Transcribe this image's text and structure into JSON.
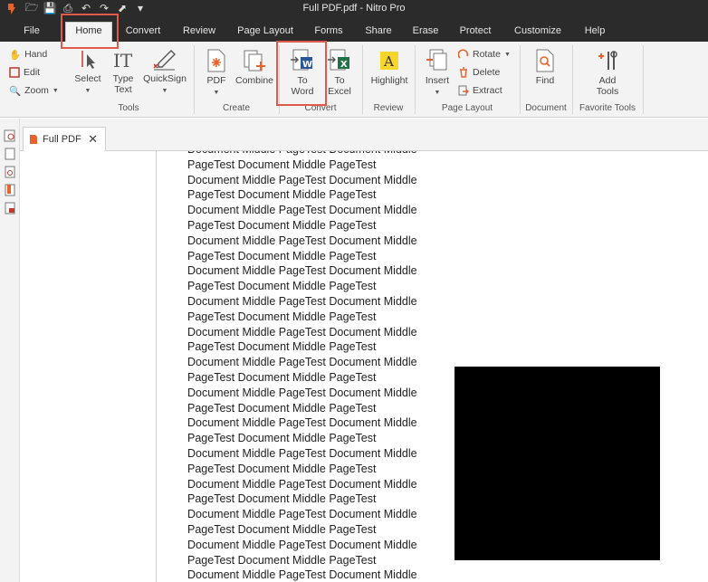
{
  "window": {
    "title": "Full PDF.pdf - Nitro Pro"
  },
  "tabs": [
    "File",
    "Home",
    "Convert",
    "Review",
    "Page Layout",
    "Forms",
    "Share",
    "Erase",
    "Protect",
    "Customize",
    "Help"
  ],
  "ribbon": {
    "tools": {
      "hand": "Hand",
      "edit": "Edit",
      "zoom": "Zoom",
      "select": "Select",
      "type_text_1": "Type",
      "type_text_2": "Text",
      "quicksign": "QuickSign",
      "group": "Tools"
    },
    "create": {
      "pdf": "PDF",
      "combine": "Combine",
      "group": "Create"
    },
    "convert": {
      "to_word_1": "To",
      "to_word_2": "Word",
      "to_excel_1": "To",
      "to_excel_2": "Excel",
      "group": "Convert"
    },
    "review": {
      "highlight": "Highlight",
      "group": "Review"
    },
    "page_layout": {
      "insert": "Insert",
      "rotate": "Rotate",
      "delete": "Delete",
      "extract": "Extract",
      "group": "Page Layout"
    },
    "document": {
      "find": "Find",
      "group": "Document"
    },
    "favorite": {
      "add_tools_1": "Add",
      "add_tools_2": "Tools",
      "group": "Favorite Tools"
    }
  },
  "document_tab": {
    "label": "Full PDF"
  },
  "page_lines": [
    "Document Middle PageTest Document Middle",
    "PageTest Document Middle PageTest",
    "Document Middle PageTest Document Middle",
    "PageTest Document Middle PageTest",
    "Document Middle PageTest Document Middle",
    "PageTest Document Middle PageTest",
    "Document Middle PageTest Document Middle",
    "PageTest Document Middle PageTest",
    "Document Middle PageTest Document Middle",
    "PageTest Document Middle PageTest",
    "Document Middle PageTest Document Middle",
    "PageTest Document Middle PageTest",
    "Document Middle PageTest Document Middle",
    "PageTest Document Middle PageTest",
    "Document Middle PageTest Document Middle",
    "PageTest Document Middle PageTest",
    "Document Middle PageTest Document Middle",
    "PageTest Document Middle PageTest",
    "Document Middle PageTest Document Middle",
    "PageTest Document Middle PageTest",
    "Document Middle PageTest Document Middle",
    "PageTest Document Middle PageTest",
    "Document Middle PageTest Document Middle",
    "PageTest Document Middle PageTest",
    "Document Middle PageTest Document Middle",
    "PageTest Document Middle PageTest",
    "Document Middle PageTest Document Middle",
    "PageTest Document Middle PageTest",
    "Document Middle PageTest Document Middle"
  ],
  "colors": {
    "accent": "#e05a4a",
    "titlebar": "#2b2b2b",
    "ribbon": "#f3f3f3"
  }
}
